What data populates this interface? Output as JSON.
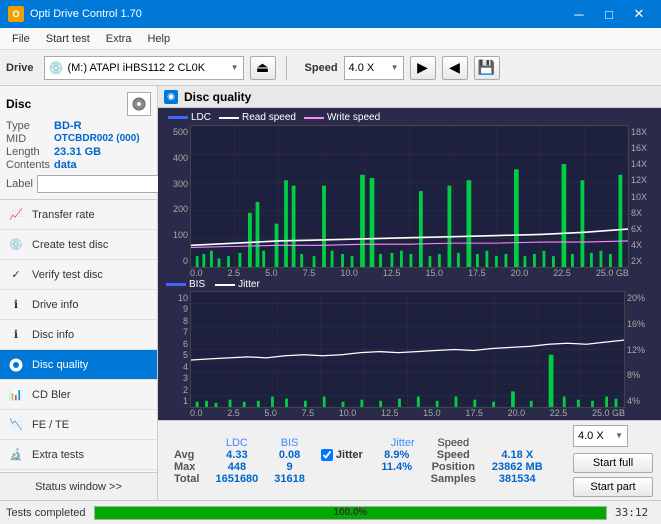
{
  "app": {
    "title": "Opti Drive Control 1.70",
    "icon": "O"
  },
  "title_bar": {
    "minimize_label": "─",
    "maximize_label": "□",
    "close_label": "✕"
  },
  "menu": {
    "items": [
      "File",
      "Start test",
      "Extra",
      "Help"
    ]
  },
  "toolbar": {
    "drive_label": "Drive",
    "drive_icon": "💿",
    "drive_value": "(M:) ATAPI iHBS112  2 CL0K",
    "speed_label": "Speed",
    "speed_value": "4.0 X",
    "eject_icon": "⏏",
    "icons": [
      "▶",
      "◀",
      "💾"
    ]
  },
  "disc": {
    "header": "Disc",
    "type_key": "Type",
    "type_val": "BD-R",
    "mid_key": "MID",
    "mid_val": "OTCBDR002 (000)",
    "length_key": "Length",
    "length_val": "23.31 GB",
    "contents_key": "Contents",
    "contents_val": "data",
    "label_key": "Label",
    "label_val": ""
  },
  "nav": {
    "items": [
      {
        "id": "transfer-rate",
        "label": "Transfer rate",
        "icon": "📈"
      },
      {
        "id": "create-test-disc",
        "label": "Create test disc",
        "icon": "💿"
      },
      {
        "id": "verify-test-disc",
        "label": "Verify test disc",
        "icon": "✓"
      },
      {
        "id": "drive-info",
        "label": "Drive info",
        "icon": "ℹ"
      },
      {
        "id": "disc-info",
        "label": "Disc info",
        "icon": "ℹ"
      },
      {
        "id": "disc-quality",
        "label": "Disc quality",
        "icon": "◉",
        "active": true
      },
      {
        "id": "cd-bler",
        "label": "CD Bler",
        "icon": "📊"
      },
      {
        "id": "fe-te",
        "label": "FE / TE",
        "icon": "📉"
      },
      {
        "id": "extra-tests",
        "label": "Extra tests",
        "icon": "🔬"
      }
    ],
    "status_window": "Status window >>"
  },
  "chart": {
    "title": "Disc quality",
    "top_legend": {
      "ldc_label": "LDC",
      "read_label": "Read speed",
      "write_label": "Write speed"
    },
    "top_y_left": [
      "500",
      "400",
      "300",
      "200",
      "100",
      "0"
    ],
    "top_y_right": [
      "18X",
      "16X",
      "14X",
      "12X",
      "10X",
      "8X",
      "6X",
      "4X",
      "2X"
    ],
    "x_axis": [
      "0.0",
      "2.5",
      "5.0",
      "7.5",
      "10.0",
      "12.5",
      "15.0",
      "17.5",
      "20.0",
      "22.5",
      "25.0 GB"
    ],
    "bottom_legend": {
      "bis_label": "BIS",
      "jitter_label": "Jitter"
    },
    "bottom_y_left": [
      "10",
      "9",
      "8",
      "7",
      "6",
      "5",
      "4",
      "3",
      "2",
      "1"
    ],
    "bottom_y_right": [
      "20%",
      "16%",
      "12%",
      "8%",
      "4%"
    ]
  },
  "stats": {
    "headers": [
      "LDC",
      "BIS",
      "",
      "Jitter",
      "Speed",
      ""
    ],
    "avg_label": "Avg",
    "avg_ldc": "4.33",
    "avg_bis": "0.08",
    "avg_jitter": "8.9%",
    "avg_speed": "4.18 X",
    "max_label": "Max",
    "max_ldc": "448",
    "max_bis": "9",
    "max_jitter": "11.4%",
    "position_label": "Position",
    "position_val": "23862 MB",
    "total_label": "Total",
    "total_ldc": "1651680",
    "total_bis": "31618",
    "samples_label": "Samples",
    "samples_val": "381534",
    "jitter_checked": true,
    "jitter_checkbox_label": "Jitter",
    "speed_display": "4.0 X",
    "start_full_label": "Start full",
    "start_part_label": "Start part"
  },
  "status_bar": {
    "text": "Tests completed",
    "progress": 100,
    "progress_label": "100.0%",
    "time": "33:12"
  }
}
